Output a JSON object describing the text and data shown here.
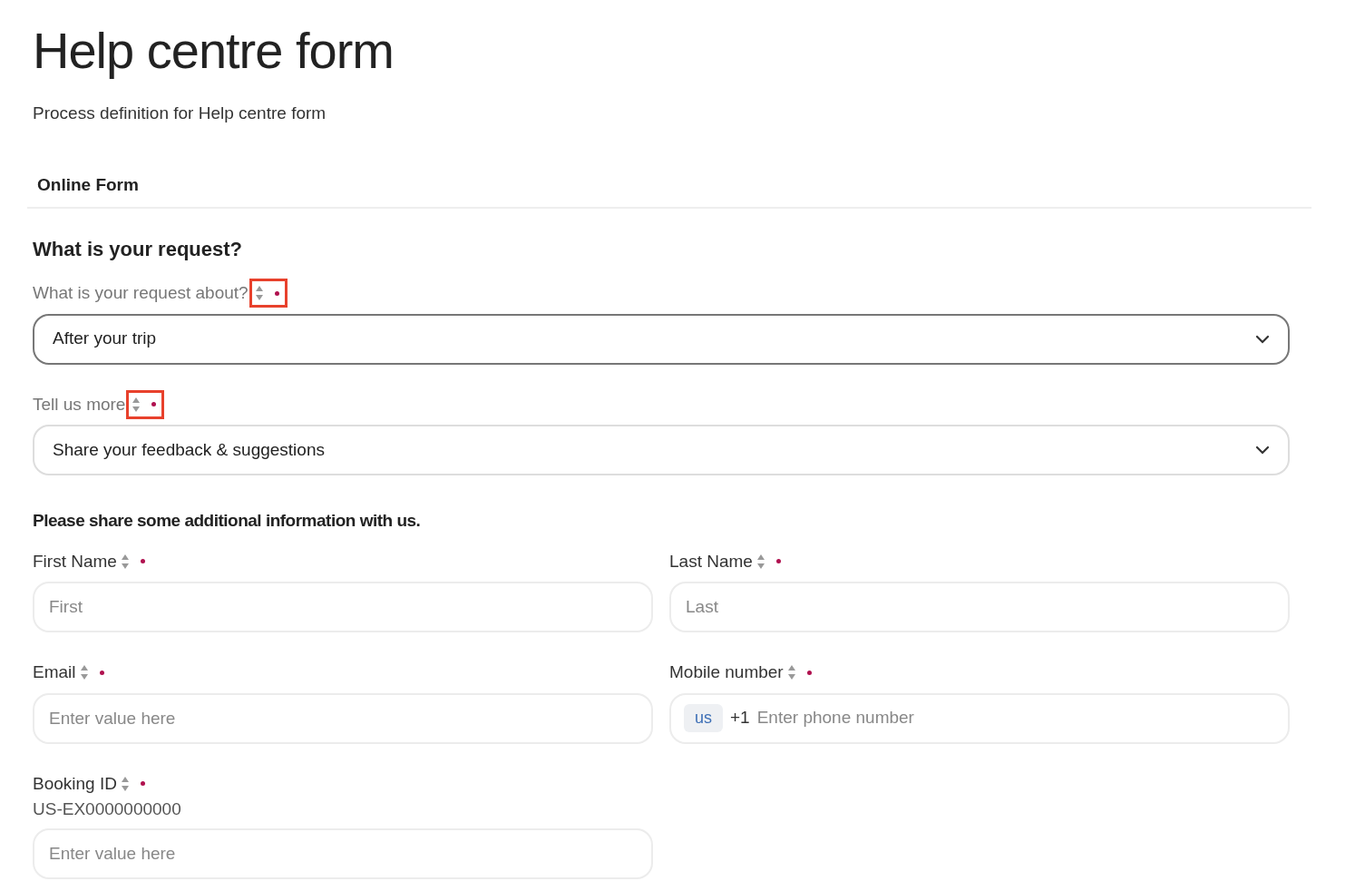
{
  "title": "Help centre form",
  "subtitle": "Process definition for Help centre form",
  "tab": {
    "label": "Online Form"
  },
  "request_heading": "What is your request?",
  "request_fields": [
    {
      "label": "What is your request about?",
      "kind": "select",
      "value": "After your trip",
      "required": true,
      "focused": true,
      "highlighted": true
    },
    {
      "label": "Tell us more",
      "kind": "select",
      "value": "Share your feedback & suggestions",
      "required": true,
      "focused": false,
      "highlighted": true
    }
  ],
  "info_heading": "Please share some additional information with us.",
  "info_fields": [
    {
      "label": "First Name",
      "kind": "text",
      "placeholder": "First",
      "required": true
    },
    {
      "label": "Last Name",
      "kind": "text",
      "placeholder": "Last",
      "required": true
    },
    {
      "label": "Email",
      "kind": "text",
      "placeholder": "Enter value here",
      "required": true
    },
    {
      "label": "Mobile number",
      "kind": "phone",
      "country": "us",
      "prefix": "+1",
      "placeholder": "Enter phone number",
      "required": true
    },
    {
      "label": "Booking ID",
      "kind": "text",
      "hint": "US-EX0000000000",
      "placeholder": "Enter value here",
      "required": true
    }
  ]
}
